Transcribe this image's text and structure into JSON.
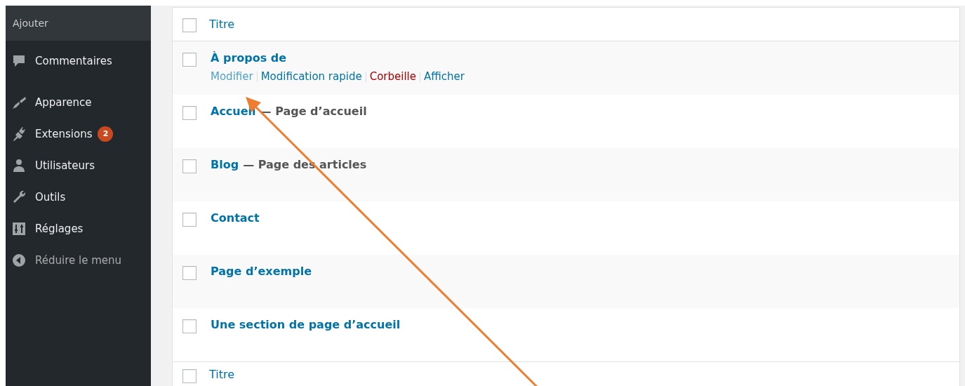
{
  "sidebar": {
    "top_item": "Ajouter",
    "items": [
      {
        "label": "Commentaires",
        "kind": "item"
      },
      {
        "label": "Apparence",
        "kind": "item"
      },
      {
        "label": "Extensions",
        "kind": "item",
        "badge": "2"
      },
      {
        "label": "Utilisateurs",
        "kind": "item"
      },
      {
        "label": "Outils",
        "kind": "item"
      },
      {
        "label": "Réglages",
        "kind": "item"
      },
      {
        "label": "Réduire le menu",
        "kind": "collapse"
      }
    ]
  },
  "table": {
    "header": {
      "label": "Titre",
      "checked": false
    },
    "rows": [
      {
        "title": "À propos de",
        "checked": false,
        "actions": [
          {
            "label": "Modifier",
            "kind": "link",
            "hovered": true
          },
          {
            "label": "Modification rapide",
            "kind": "link",
            "hovered": false
          },
          {
            "label": "Corbeille",
            "kind": "delete",
            "hovered": false
          },
          {
            "label": "Afficher",
            "kind": "link",
            "hovered": false
          }
        ]
      },
      {
        "title": "Accueil",
        "state": "— Page d’accueil",
        "checked": false
      },
      {
        "title": "Blog",
        "state": "— Page des articles",
        "checked": false
      },
      {
        "title": "Contact",
        "checked": false
      },
      {
        "title": "Page d’exemple",
        "checked": false
      },
      {
        "title": "Une section de page d’accueil",
        "checked": false
      }
    ],
    "footer": {
      "label": "Titre",
      "checked": false
    }
  }
}
